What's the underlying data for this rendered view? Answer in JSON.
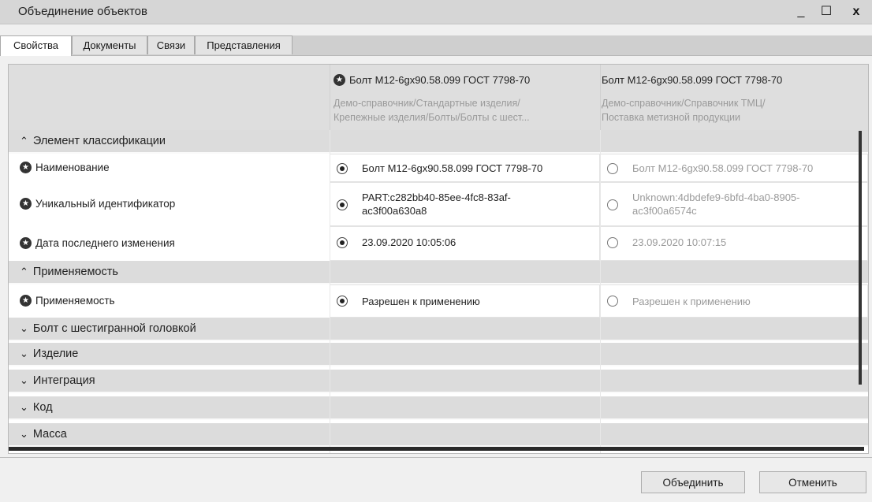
{
  "window": {
    "title": "Объединение объектов",
    "minimize": "_",
    "maximize": "☐",
    "close": "x"
  },
  "tabs": [
    {
      "label": "Свойства",
      "active": true
    },
    {
      "label": "Документы"
    },
    {
      "label": "Связи"
    },
    {
      "label": "Представления"
    }
  ],
  "columns": [
    {
      "title": "Болт М12-6gx90.58.099 ГОСТ 7798-70",
      "path1": "Демо-справочник/Стандартные изделия/",
      "path2": "Крепежные изделия/Болты/Болты с шест...",
      "starred": true
    },
    {
      "title": "Болт М12-6gx90.58.099 ГОСТ 7798-70",
      "path1": "Демо-справочник/Справочник ТМЦ/",
      "path2": "Поставка метизной продукции",
      "starred": false
    }
  ],
  "groups": {
    "classification": "Элемент классификации",
    "applicability": "Применяемость",
    "bolt": "Болт с шестигранной головкой",
    "product": "Изделие",
    "integration": "Интеграция",
    "code": "Код",
    "mass": "Масса"
  },
  "rows": {
    "name": {
      "label": "Наименование",
      "v1": "Болт М12-6gx90.58.099 ГОСТ 7798-70",
      "v2": "Болт М12-6gx90.58.099 ГОСТ 7798-70"
    },
    "uid": {
      "label": "Уникальный идентификатор",
      "v1a": "PART:c282bb40-85ee-4fc8-83af-",
      "v1b": "ac3f00a630a8",
      "v2a": "Unknown:4dbdefe9-6bfd-4ba0-8905-",
      "v2b": "ac3f00a6574c"
    },
    "modified": {
      "label": "Дата последнего изменения",
      "v1": "23.09.2020 10:05:06",
      "v2": "23.09.2020 10:07:15"
    },
    "applicability": {
      "label": "Применяемость",
      "v1": "Разрешен к применению",
      "v2": "Разрешен к применению"
    }
  },
  "selection": "first-column",
  "buttons": {
    "merge": "Объединить",
    "cancel": "Отменить"
  }
}
